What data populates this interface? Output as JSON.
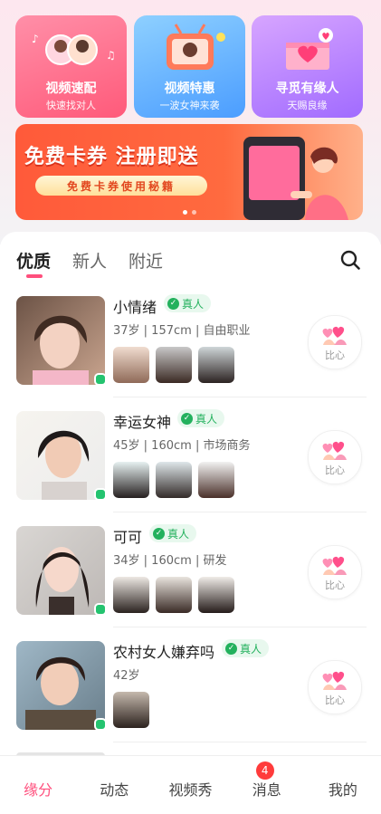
{
  "feature_cards": [
    {
      "title": "视频速配",
      "subtitle": "快速找对人"
    },
    {
      "title": "视频特惠",
      "subtitle": "一波女神来袭"
    },
    {
      "title": "寻觅有缘人",
      "subtitle": "天赐良缘"
    }
  ],
  "banner": {
    "headline": "免费卡券 注册即送",
    "pill": "免费卡券使用秘籍",
    "page_count": 2,
    "active_page": 1
  },
  "tabs": [
    "优质",
    "新人",
    "附近"
  ],
  "active_tab": 0,
  "icons": {
    "search": "search-icon",
    "like": "hearts-icon",
    "verified": "check-icon"
  },
  "colors": {
    "accent": "#ff4f7d",
    "verified": "#23b15d",
    "online": "#24c36f"
  },
  "users": [
    {
      "name": "小情绪",
      "badge": "真人",
      "info": "37岁 | 157cm | 自由职业",
      "photos": 3,
      "like_label": "比心"
    },
    {
      "name": "幸运女神",
      "badge": "真人",
      "info": "45岁 | 160cm | 市场商务",
      "photos": 3,
      "like_label": "比心"
    },
    {
      "name": "可可",
      "badge": "真人",
      "info": "34岁 | 160cm | 研发",
      "photos": 3,
      "like_label": "比心"
    },
    {
      "name": "农村女人嫌弃吗",
      "badge": "真人",
      "info": "42岁",
      "photos": 1,
      "like_label": "比心"
    }
  ],
  "nav": {
    "items": [
      "缘分",
      "动态",
      "视频秀",
      "消息",
      "我的"
    ],
    "active": 0,
    "message_badge": "4"
  }
}
